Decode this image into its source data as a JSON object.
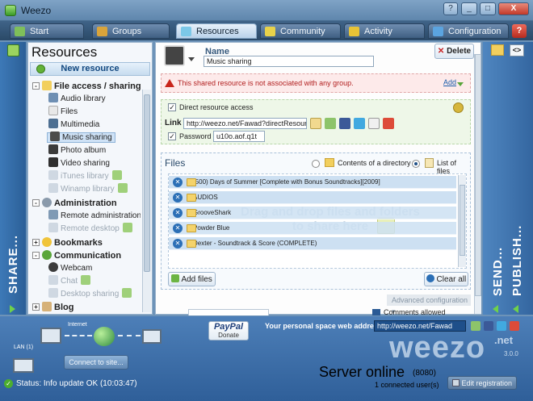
{
  "window": {
    "title": "Weezo",
    "controls": [
      "?",
      "_",
      "□",
      "X"
    ]
  },
  "tabs": [
    {
      "label": "Start",
      "icon": "home-icon",
      "color": "#7fbf5a"
    },
    {
      "label": "Groups",
      "icon": "groups-icon",
      "color": "#d9a43b"
    },
    {
      "label": "Resources",
      "icon": "resources-icon",
      "color": "#7cc8e8",
      "active": true
    },
    {
      "label": "Community",
      "icon": "community-icon",
      "color": "#e8d24a"
    },
    {
      "label": "Activity",
      "icon": "activity-icon",
      "color": "#e7c336"
    },
    {
      "label": "Configuration",
      "icon": "configuration-icon",
      "color": "#5ba4e0"
    }
  ],
  "left_strip": {
    "label": "SHARE..."
  },
  "resources": {
    "title": "Resources",
    "new_resource": "New resource",
    "tree": [
      {
        "label": "File access / sharing",
        "type": "group",
        "expanded": true
      },
      {
        "label": "Audio library"
      },
      {
        "label": "Files"
      },
      {
        "label": "Multimedia"
      },
      {
        "label": "Music sharing",
        "selected": true
      },
      {
        "label": "Photo album"
      },
      {
        "label": "Video sharing"
      },
      {
        "label": "iTunes library",
        "disabled": true
      },
      {
        "label": "Winamp library",
        "disabled": true
      },
      {
        "label": "Administration",
        "type": "group",
        "expanded": true
      },
      {
        "label": "Remote administration"
      },
      {
        "label": "Remote desktop",
        "disabled": true
      },
      {
        "label": "Bookmarks",
        "type": "group",
        "expanded": false
      },
      {
        "label": "Communication",
        "type": "group",
        "expanded": true
      },
      {
        "label": "Webcam"
      },
      {
        "label": "Chat",
        "disabled": true
      },
      {
        "label": "Desktop sharing",
        "disabled": true
      },
      {
        "label": "Blog",
        "type": "group",
        "expanded": false
      }
    ]
  },
  "detail": {
    "name_label": "Name",
    "name_value": "Music sharing",
    "delete_label": "Delete",
    "warning": "This shared resource is not associated with any group.",
    "add_label": "Add",
    "direct_access": "Direct resource access",
    "link_label": "Link",
    "link_value": "http://weezo.net/Fawad?directResour",
    "password_label": "Password",
    "password_value": "u10o.aof.q1t",
    "files_title": "Files",
    "radio_contents": "Contents of a directory",
    "radio_list": "List of files",
    "files": [
      "(500) Days of Summer [Complete with Bonus Soundtracks][2009]",
      "AUDIOS",
      "GrooveShark",
      "Powder Blue",
      "Dexter - Soundtrack & Score (COMPLETE)"
    ],
    "drop_hint": "Drag and drop files and folders to share here",
    "add_files": "Add files",
    "clear_all": "Clear all",
    "advanced": "Advanced configuration",
    "comments_allowed": "Comments allowed"
  },
  "right_panel": {
    "send": "SEND...",
    "publish": "PUBLISH...",
    "code": "<>"
  },
  "bottom": {
    "internet_label": "Internet",
    "lan_label": "LAN (1)",
    "connect_button": "Connect to site...",
    "paypal": "PayPal",
    "donate": "Donate",
    "web_address_label": "Your personal space web address",
    "web_address_value": "http://weezo.net/Fawad",
    "brand": "weezo",
    "brand_tld": ".net",
    "version": "3.0.0",
    "server_status": "Server online",
    "port": "(8080)",
    "connected_users": "1 connected user(s)",
    "edit_registration": "Edit registration",
    "status_text": "Status: Info update OK (10:03:47)"
  }
}
